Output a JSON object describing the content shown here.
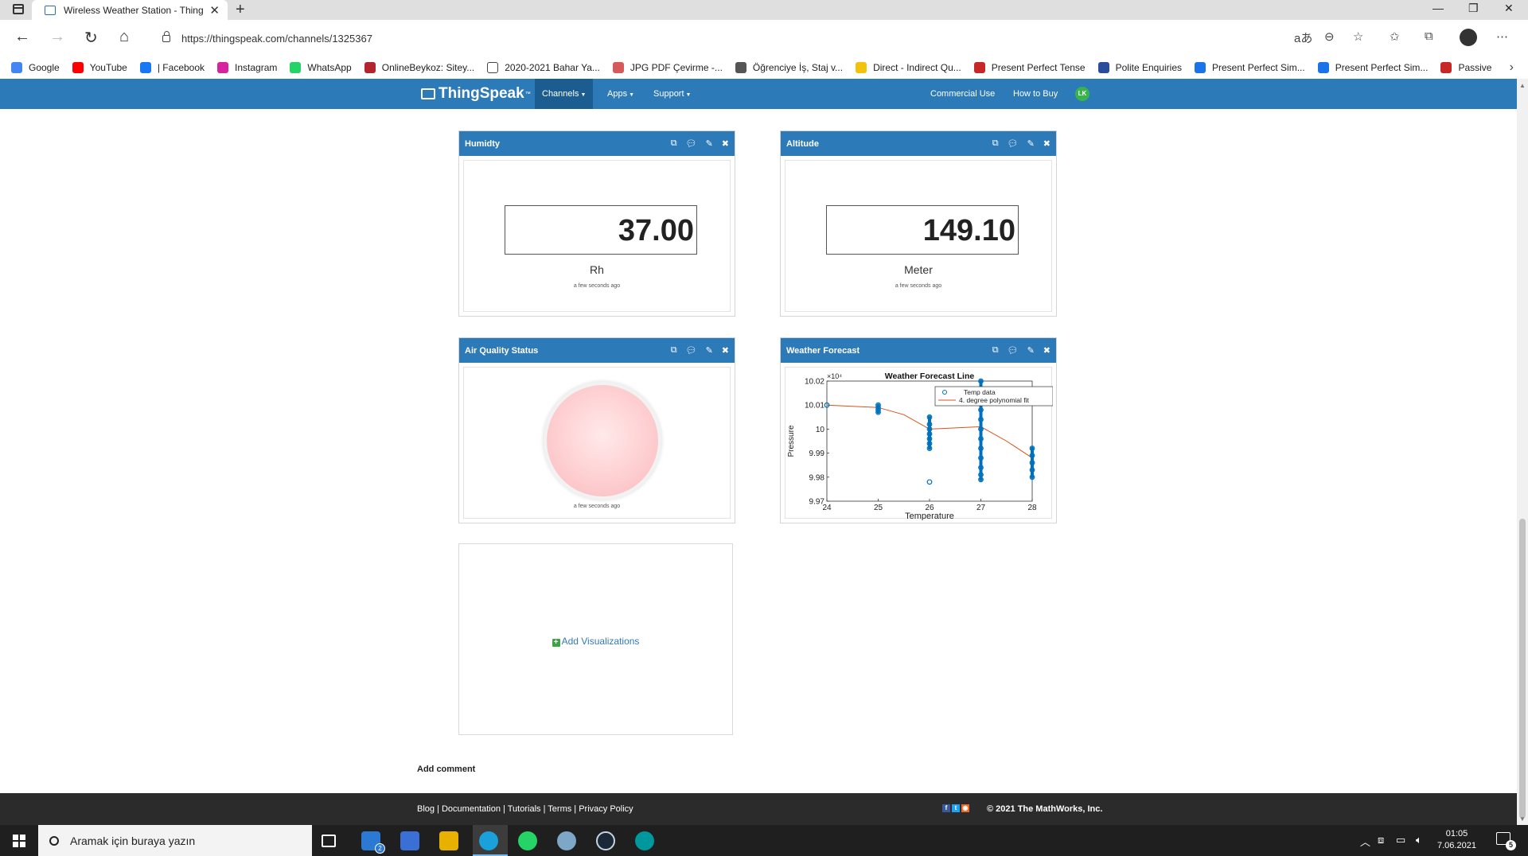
{
  "browser": {
    "tab_title": "Wireless Weather Station - ThingSpeak",
    "url": "https://thingspeak.com/channels/1325367"
  },
  "bookmarks": [
    {
      "label": "Google",
      "icon": "google-icon",
      "color": "#4285f4"
    },
    {
      "label": "YouTube",
      "icon": "youtube-icon",
      "color": "#ff0000"
    },
    {
      "label": "| Facebook",
      "icon": "facebook-icon",
      "color": "#1877f2"
    },
    {
      "label": "Instagram",
      "icon": "instagram-icon",
      "color": "#d6249f"
    },
    {
      "label": "WhatsApp",
      "icon": "whatsapp-icon",
      "color": "#25d366"
    },
    {
      "label": "OnlineBeykoz: Sitey...",
      "icon": "onlinebeykoz-icon",
      "color": "#b3262d"
    },
    {
      "label": "2020-2021 Bahar Ya...",
      "icon": "document-icon",
      "color": "#ffffff"
    },
    {
      "label": "JPG PDF Çevirme -...",
      "icon": "jpg-pdf-icon",
      "color": "#d65a5a"
    },
    {
      "label": "Öğrenciye İş, Staj v...",
      "icon": "student-job-icon",
      "color": "#555555"
    },
    {
      "label": "Direct - Indirect Qu...",
      "icon": "folder-bookmark-icon",
      "color": "#f4c20d"
    },
    {
      "label": "Present Perfect Tense",
      "icon": "present-perfect-icon",
      "color": "#c62828"
    },
    {
      "label": "Polite Enquiries",
      "icon": "polite-enquiries-icon",
      "color": "#2a4d9b"
    },
    {
      "label": "Present Perfect Sim...",
      "icon": "present-perfect-sim-icon",
      "color": "#1a73e8"
    },
    {
      "label": "Present Perfect Sim...",
      "icon": "present-perfect-sim-icon",
      "color": "#1a73e8"
    },
    {
      "label": "Passive",
      "icon": "passive-icon",
      "color": "#c62828"
    }
  ],
  "thingspeak_nav": {
    "logo": "ThingSpeak",
    "logo_tm": "™",
    "channels": "Channels",
    "apps": "Apps",
    "support": "Support",
    "commercial_use": "Commercial Use",
    "how_to_buy": "How to Buy",
    "user_initials": "LK"
  },
  "widgets": {
    "humidity": {
      "title": "Humidty",
      "value": "37.00",
      "units": "Rh",
      "updated": "a few seconds ago"
    },
    "altitude": {
      "title": "Altitude",
      "value": "149.10",
      "units": "Meter",
      "updated": "a few seconds ago"
    },
    "air_quality": {
      "title": "Air Quality Status",
      "updated": "a few seconds ago",
      "lamp_color": "#ffd4d6"
    },
    "weather_forecast": {
      "title": "Weather Forecast"
    }
  },
  "chart_data": {
    "type": "scatter",
    "title": "Weather Forecast Line",
    "xlabel": "Temperature",
    "ylabel": "Pressure",
    "y_multiplier": "×10⁴",
    "xlim": [
      24,
      28
    ],
    "ylim": [
      9.97,
      10.02
    ],
    "x_ticks": [
      "24",
      "25",
      "26",
      "27",
      "28"
    ],
    "y_ticks": [
      "10.02",
      "10.01",
      "10",
      "9.99",
      "9.98",
      "9.97"
    ],
    "legend_position": "top-right",
    "series": [
      {
        "name": "Temp data",
        "marker": "circle",
        "color": "#0072bd",
        "points": [
          [
            24,
            10.01
          ],
          [
            25,
            10.01
          ],
          [
            25,
            10.009
          ],
          [
            25,
            10.008
          ],
          [
            25,
            10.007
          ],
          [
            26,
            10.005
          ],
          [
            26,
            10.002
          ],
          [
            26,
            10.0
          ],
          [
            26,
            9.998
          ],
          [
            26,
            9.996
          ],
          [
            26,
            9.994
          ],
          [
            26,
            9.992
          ],
          [
            26,
            9.978
          ],
          [
            27,
            10.02
          ],
          [
            27,
            10.008
          ],
          [
            27,
            10.004
          ],
          [
            27,
            10.0
          ],
          [
            27,
            9.996
          ],
          [
            27,
            9.992
          ],
          [
            27,
            9.988
          ],
          [
            27,
            9.984
          ],
          [
            27,
            9.981
          ],
          [
            27,
            9.979
          ],
          [
            28,
            9.992
          ],
          [
            28,
            9.989
          ],
          [
            28,
            9.986
          ],
          [
            28,
            9.983
          ],
          [
            28,
            9.98
          ]
        ]
      },
      {
        "name": "4. degree polynomial fit",
        "marker": "line",
        "color": "#d95319",
        "points": [
          [
            24,
            10.01
          ],
          [
            24.5,
            10.0095
          ],
          [
            25,
            10.009
          ],
          [
            25.5,
            10.006
          ],
          [
            26,
            10.0
          ],
          [
            26.5,
            10.0005
          ],
          [
            27,
            10.001
          ],
          [
            27.5,
            9.995
          ],
          [
            28,
            9.988
          ]
        ]
      }
    ]
  },
  "add_visualizations": "Add Visualizations",
  "add_comment": "Add comment",
  "footer": {
    "links": "Blog | Documentation | Tutorials | Terms | Privacy Policy",
    "copyright": "© 2021 The MathWorks, Inc."
  },
  "taskbar": {
    "search_placeholder": "Aramak için buraya yazın",
    "time": "01:05",
    "date": "7.06.2021",
    "mail_badge": "2",
    "notification_count": "5"
  }
}
